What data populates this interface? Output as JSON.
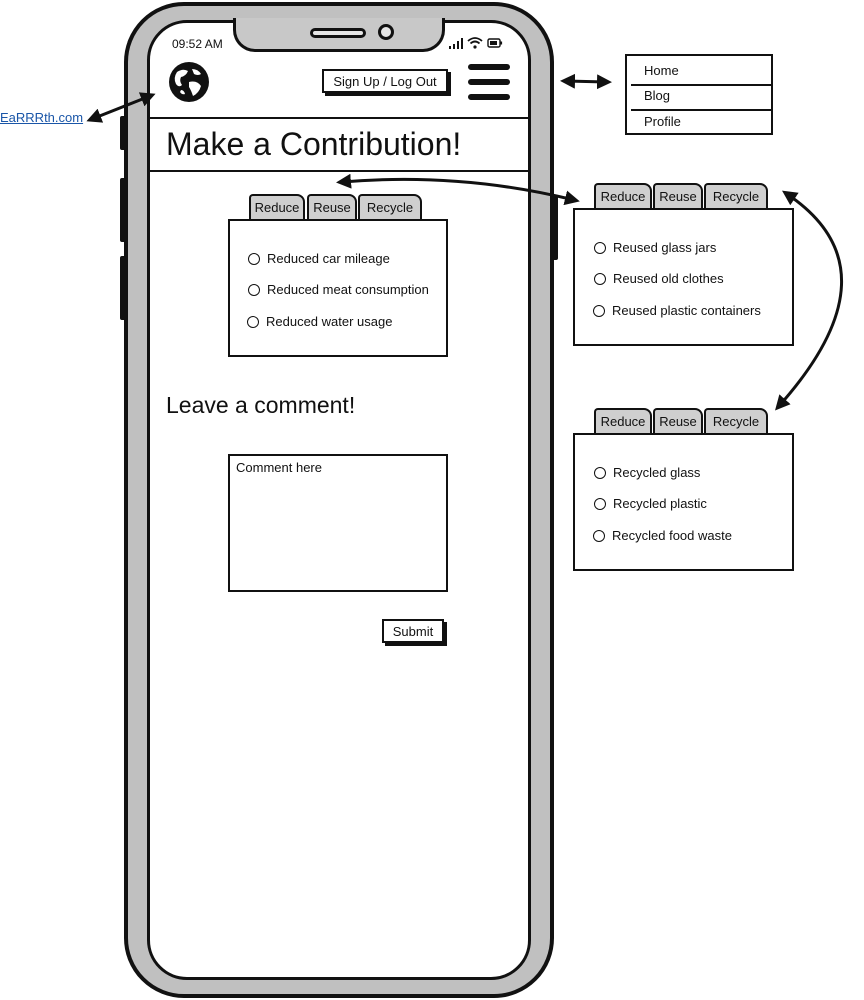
{
  "status_bar": {
    "time": "09:52 AM"
  },
  "header": {
    "signup_label": "Sign Up / Log Out"
  },
  "page": {
    "title": "Make a Contribution!",
    "comment_heading": "Leave a comment!",
    "comment_placeholder": "Comment here",
    "submit_label": "Submit"
  },
  "tabs": [
    "Reduce",
    "Reuse",
    "Recycle"
  ],
  "panels": {
    "reduce": {
      "options": [
        "Reduced car mileage",
        "Reduced meat consumption",
        "Reduced water usage"
      ]
    },
    "reuse": {
      "options": [
        "Reused glass jars",
        "Reused old clothes",
        "Reused plastic containers"
      ]
    },
    "recycle": {
      "options": [
        "Recycled glass",
        "Recycled plastic",
        "Recycled food waste"
      ]
    }
  },
  "annotations": {
    "site_link": "EaRRRth.com",
    "menu": [
      "Home",
      "Blog",
      "Profile"
    ]
  }
}
